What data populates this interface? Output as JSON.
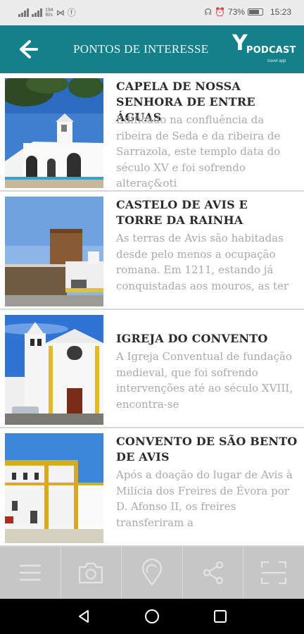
{
  "status_bar": {
    "net_speed_value": "194",
    "net_speed_unit": "B/s",
    "battery_percent": "73%",
    "time": "15:23"
  },
  "header": {
    "title": "PONTOS DE INTERESSE",
    "logo_y": "Y",
    "logo_text": "PODCAST",
    "logo_sub": "travel app"
  },
  "items": [
    {
      "title": "CAPELA DE NOSSA SENHORA DE ENTRE ÁGUAS",
      "description": "Edificado na confluência da ribeira de Seda e da ribeira de Sarrazola, este templo data do século XV e foi sofrendo alteraç&oti"
    },
    {
      "title": "CASTELO DE AVIS E TORRE DA RAINHA",
      "description": "As terras de Avis são habitadas desde pelo menos a ocupação romana. Em 1211, estando já conquistadas aos mouros, as ter"
    },
    {
      "title": "IGREJA DO CONVENTO",
      "description": "A Igreja Conventual de fundação medieval, que foi sofrendo intervenções até ao século XVIII, encontra-se"
    },
    {
      "title": "CONVENTO DE SÃO BENTO DE AVIS",
      "description": "Após a doação do lugar de Avis à Milícia dos Freires de Évora por D. Afonso II, os freires transferiram a"
    }
  ],
  "toolbar": [
    "menu-icon",
    "camera-icon",
    "location-pin-icon",
    "share-icon",
    "scan-icon"
  ],
  "colors": {
    "header_bg": "#14818a",
    "toolbar_bg": "#c6c6c6",
    "title_text": "#2b2b2b",
    "desc_text": "#a9a9a9"
  }
}
